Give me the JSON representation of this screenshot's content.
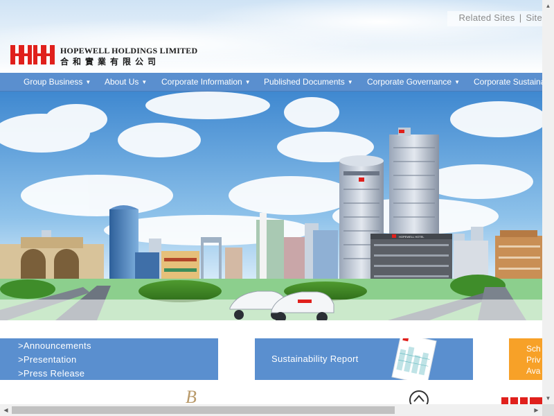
{
  "top_links": {
    "related_sites": "Related Sites",
    "separator": "|",
    "site": "Site"
  },
  "logo": {
    "en": "HOPEWELL HOLDINGS LIMITED",
    "zh": "合和實業有限公司",
    "brand_color": "#e0201c"
  },
  "nav": {
    "color": "#5a8fcf",
    "items": [
      {
        "label": "Group Business"
      },
      {
        "label": "About Us"
      },
      {
        "label": "Corporate Information"
      },
      {
        "label": "Published Documents"
      },
      {
        "label": "Corporate Governance"
      },
      {
        "label": "Corporate Sustaina"
      }
    ]
  },
  "hero": {
    "sign": "HOPEWELL HOTEL"
  },
  "announcements": {
    "links": [
      {
        "label": ">Announcements"
      },
      {
        "label": ">Presentation"
      },
      {
        "label": ">Press Release"
      }
    ]
  },
  "sustainability": {
    "label": "Sustainability Report"
  },
  "promo": {
    "lines": [
      "Sch",
      "Priv",
      "Ava"
    ],
    "color": "#f7a128"
  }
}
